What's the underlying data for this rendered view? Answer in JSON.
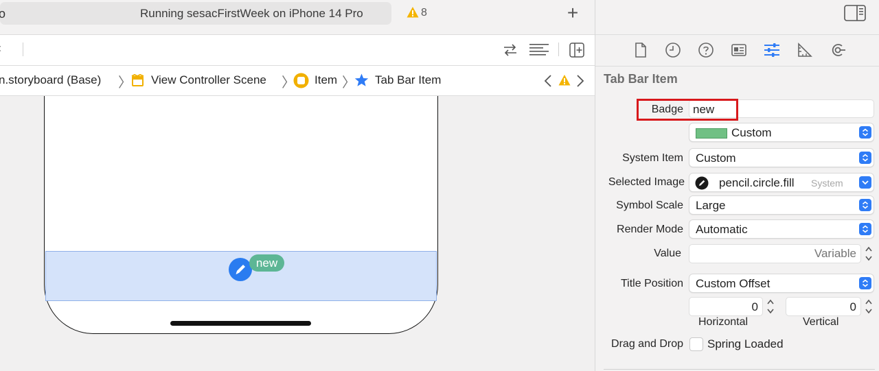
{
  "status": {
    "left_fragment": "o",
    "text": "Running sesacFirstWeek on iPhone 14 Pro",
    "warning_count": "8",
    "add_label": "+"
  },
  "toolbar": {
    "left_fragment": "‹"
  },
  "jumpbar": {
    "items": [
      {
        "label": "n.storyboard (Base)"
      },
      {
        "label": "View Controller Scene"
      },
      {
        "label": "Item"
      },
      {
        "label": "Tab Bar Item"
      }
    ]
  },
  "canvas": {
    "badge_text": "new"
  },
  "inspector": {
    "section_title": "Tab Bar Item",
    "badge": {
      "label": "Badge",
      "value": "new"
    },
    "badge_color": {
      "value": "Custom",
      "color": "#70c084"
    },
    "system_item": {
      "label": "System Item",
      "value": "Custom"
    },
    "selected_image": {
      "label": "Selected Image",
      "value": "pencil.circle.fill",
      "hint": "System"
    },
    "symbol_scale": {
      "label": "Symbol Scale",
      "value": "Large"
    },
    "render_mode": {
      "label": "Render Mode",
      "value": "Automatic"
    },
    "value": {
      "label": "Value",
      "placeholder": "Variable"
    },
    "title_position": {
      "label": "Title Position",
      "value": "Custom Offset",
      "horizontal": "0",
      "vertical": "0",
      "horizontal_label": "Horizontal",
      "vertical_label": "Vertical"
    },
    "drag_drop": {
      "label": "Drag and Drop",
      "checkbox_label": "Spring Loaded",
      "checked": false
    }
  },
  "colors": {
    "accent": "#2f7cf6",
    "badge_green": "#5db695",
    "selection_blue": "#d5e3fa",
    "highlight_red": "#d8191c",
    "warning": "#f4b400"
  }
}
